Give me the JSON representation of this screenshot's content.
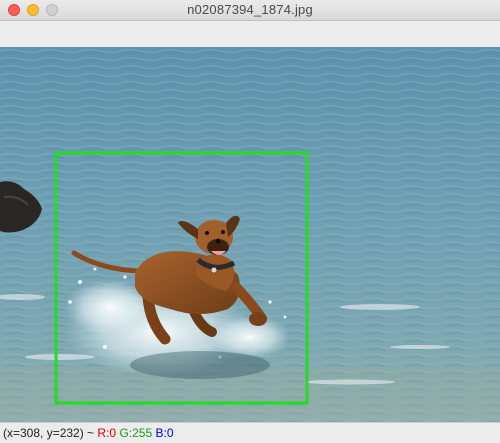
{
  "window": {
    "title": "n02087394_1874.jpg"
  },
  "image": {
    "subject_icon": "dog-photo",
    "bbox_color": "#22dd22"
  },
  "status": {
    "coords": "(x=308, y=232) ~",
    "r": "R:0",
    "g": "G:255",
    "b": "B:0"
  },
  "colors": {
    "close": "#ff5f57",
    "minimize": "#febc2e",
    "maximize": "#d0d0d0"
  }
}
